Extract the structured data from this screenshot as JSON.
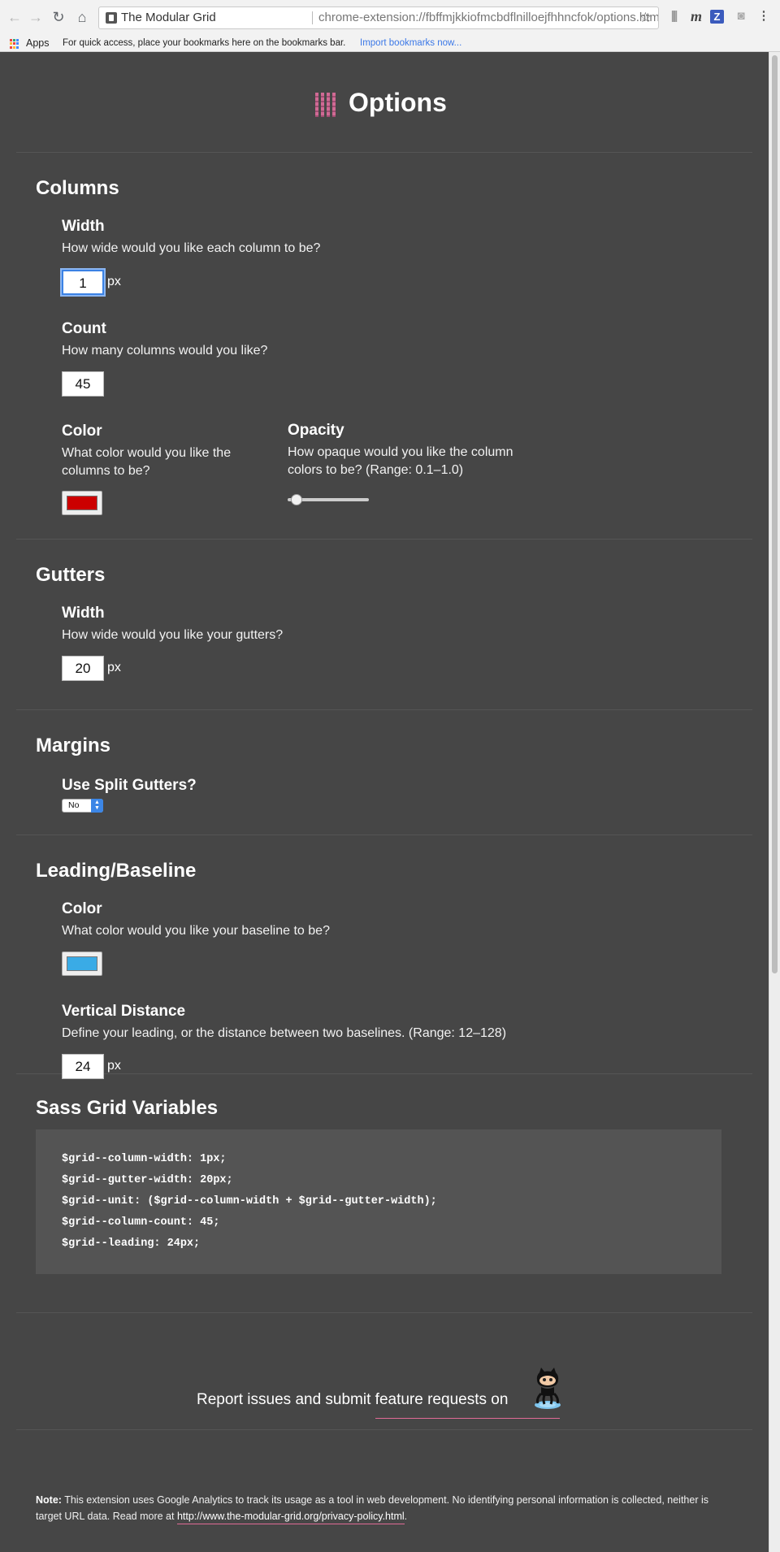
{
  "browser": {
    "site_name": "The Modular Grid",
    "url": "chrome-extension://fbffmjkkiofmcbdflnilloejfhhncfok/options.html",
    "apps_label": "Apps",
    "bookmarks_hint": "For quick access, place your bookmarks here on the bookmarks bar.",
    "bookmarks_link": "Import bookmarks now..."
  },
  "header": {
    "title": "Options"
  },
  "columns": {
    "title": "Columns",
    "width": {
      "label": "Width",
      "desc": "How wide would you like each column to be?",
      "value": "1",
      "unit": "px"
    },
    "count": {
      "label": "Count",
      "desc": "How many columns would you like?",
      "value": "45"
    },
    "color": {
      "label": "Color",
      "desc": "What color would you like the columns to be?",
      "value": "#cc0000"
    },
    "opacity": {
      "label": "Opacity",
      "desc": "How opaque would you like the column colors to be? (Range: 0.1–1.0)",
      "value": 0.2
    }
  },
  "gutters": {
    "title": "Gutters",
    "width": {
      "label": "Width",
      "desc": "How wide would you like your gutters?",
      "value": "20",
      "unit": "px"
    }
  },
  "margins": {
    "title": "Margins",
    "split": {
      "label": "Use Split Gutters?",
      "value": "No"
    }
  },
  "leading": {
    "title": "Leading/Baseline",
    "color": {
      "label": "Color",
      "desc": "What color would you like your baseline to be?",
      "value": "#3aabe6"
    },
    "distance": {
      "label": "Vertical Distance",
      "desc": "Define your leading, or the distance between two baselines. (Range: 12–128)",
      "value": "24",
      "unit": "px"
    }
  },
  "sass": {
    "title": "Sass Grid Variables",
    "lines": [
      "$grid--column-width: 1px;",
      "$grid--gutter-width: 20px;",
      "$grid--unit: ($grid--column-width + $grid--gutter-width);",
      "$grid--column-count: 45;",
      "$grid--leading: 24px;"
    ]
  },
  "footer": {
    "report_prefix": "Report issues and submit ",
    "report_link": "feature requests on",
    "note_label": "Note:",
    "note_text": " This extension uses Google Analytics to track its usage as a tool in web development. No identifying personal information is collected, neither is target URL data. Read more at ",
    "note_link": "http://www.the-modular-grid.org/privacy-policy.html",
    "note_end": "."
  },
  "colors": {
    "background": "#464646",
    "accent": "#e06a96",
    "focus": "#3b82e4"
  }
}
